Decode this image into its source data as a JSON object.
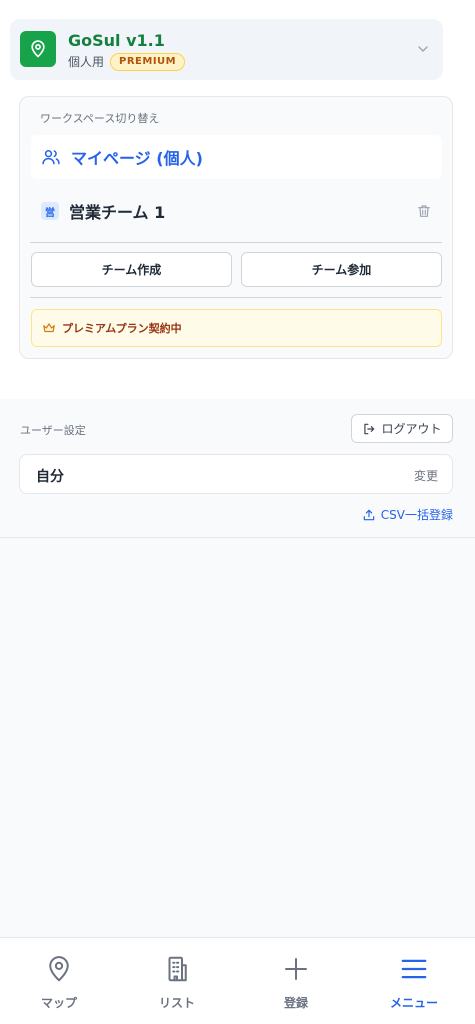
{
  "app": {
    "title": "GoSul v1.1",
    "plan": "個人用",
    "badge": "PREMIUM"
  },
  "workspace": {
    "caption": "ワークスペース切り替え",
    "personal": "マイページ (個人)",
    "team_badge": "営",
    "team": "営業チーム 1",
    "create_team": "チーム作成",
    "join_team": "チーム参加",
    "premium_contract": "プレミアムプラン契約中"
  },
  "settings": {
    "caption": "ユーザー設定",
    "logout": "ログアウト",
    "user_name": "自分",
    "change": "変更",
    "csv_import": "CSV一括登録"
  },
  "nav": {
    "items": [
      {
        "label": "マップ",
        "icon": "map-pin-icon",
        "active": false
      },
      {
        "label": "リスト",
        "icon": "building-icon",
        "active": false
      },
      {
        "label": "登録",
        "icon": "plus-icon",
        "active": false
      },
      {
        "label": "メニュー",
        "icon": "menu-icon",
        "active": true
      }
    ]
  },
  "colors": {
    "brand_green": "#16a34a",
    "accent_blue": "#2563eb",
    "premium_amber": "#b45309"
  }
}
